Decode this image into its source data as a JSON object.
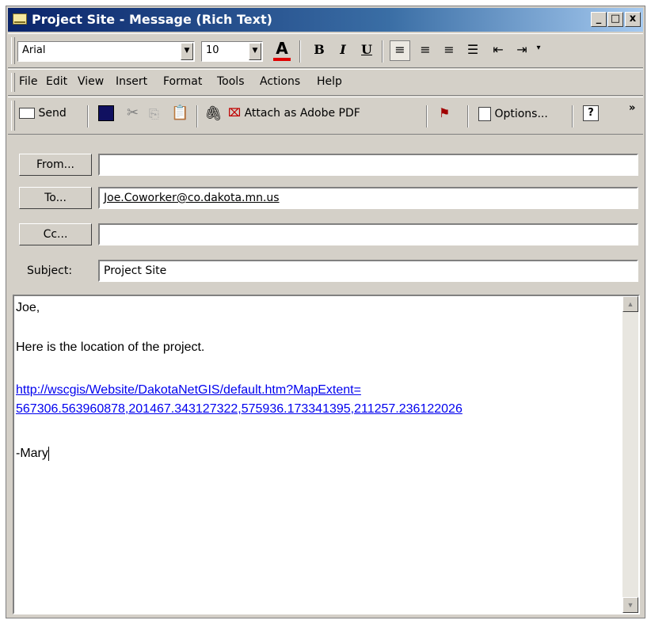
{
  "window": {
    "title": "Project Site - Message (Rich Text)",
    "controls": {
      "minimize": "_",
      "maximize": "□",
      "close": "x"
    }
  },
  "format_toolbar": {
    "font": "Arial",
    "size": "10",
    "font_color_label": "A",
    "bold": "B",
    "italic": "I",
    "underline": "U",
    "font_color_accent": "#e00000"
  },
  "menu": {
    "items": [
      "File",
      "Edit",
      "View",
      "Insert",
      "Format",
      "Tools",
      "Actions",
      "Help"
    ]
  },
  "standard_toolbar": {
    "send": "Send",
    "attach_pdf": "Attach as Adobe PDF",
    "options": "Options...",
    "more": "»"
  },
  "fields": {
    "from_button": "From...",
    "to_button": "To...",
    "cc_button": "Cc...",
    "subject_label": "Subject:",
    "from_value": "",
    "to_value": "Joe.Coworker@co.dakota.mn.us",
    "cc_value": "",
    "subject_value": "Project Site"
  },
  "message": {
    "greeting": "Joe,",
    "line1": "Here is the location of the project.",
    "link_line1": "http://wscgis/Website/DakotaNetGIS/default.htm?MapExtent=",
    "link_line2": "567306.563960878,201467.343127322,575936.173341395,211257.236122026",
    "signature": "-Mary"
  },
  "colors": {
    "titlebar_start": "#0a246a",
    "titlebar_end": "#a6caf0",
    "link": "#0000ee",
    "chrome": "#d4d0c8"
  }
}
